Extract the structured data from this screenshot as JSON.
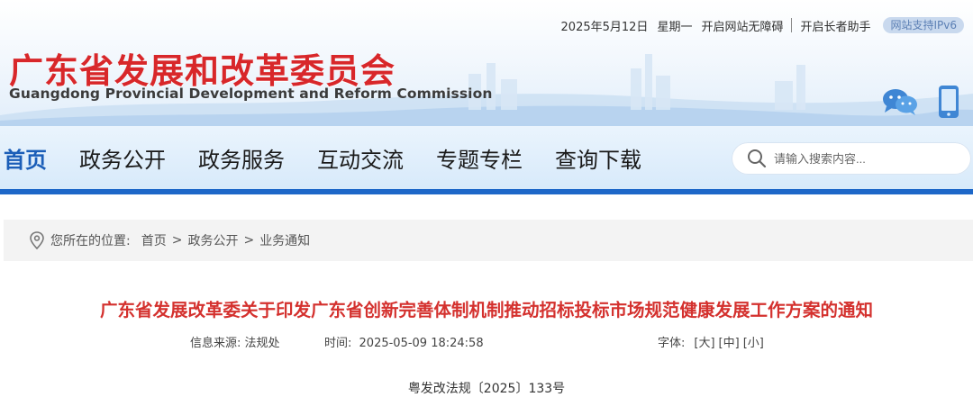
{
  "topbar": {
    "date": "2025年5月12日",
    "weekday": "星期一",
    "accessibility_link": "开启网站无障碍",
    "elderly_link": "开启长者助手",
    "ipv6_badge": "网站支持IPv6"
  },
  "logo": {
    "name_cn": "广东省发展和改革委员会",
    "name_en": "Guangdong Provincial Development and Reform Commission"
  },
  "header_icons": [
    "wechat-icon",
    "mobile-icon"
  ],
  "nav": {
    "items": [
      {
        "label": "首页",
        "active": true
      },
      {
        "label": "政务公开",
        "active": false
      },
      {
        "label": "政务服务",
        "active": false
      },
      {
        "label": "互动交流",
        "active": false
      },
      {
        "label": "专题专栏",
        "active": false
      },
      {
        "label": "查询下载",
        "active": false
      }
    ]
  },
  "search": {
    "placeholder": "请输入搜索内容...",
    "icon": "search-icon"
  },
  "breadcrumb": {
    "label": "您所在的位置:",
    "items": [
      "首页",
      "政务公开",
      "业务通知"
    ]
  },
  "article": {
    "title": "广东省发展改革委关于印发广东省创新完善体制机制推动招标投标市场规范健康发展工作方案的通知",
    "source_label": "信息来源:",
    "source": "法规处",
    "time_label": "时间:",
    "time": "2025-05-09 18:24:58",
    "font_label": "字体:",
    "font_sizes": [
      "[大]",
      "[中]",
      "[小]"
    ],
    "doc_number": "粤发改法规〔2025〕133号"
  },
  "colors": {
    "brand_red": "#d8272a",
    "title_red": "#d4312e",
    "nav_blue": "#1d67c8",
    "active_nav": "#1b5eb8"
  }
}
